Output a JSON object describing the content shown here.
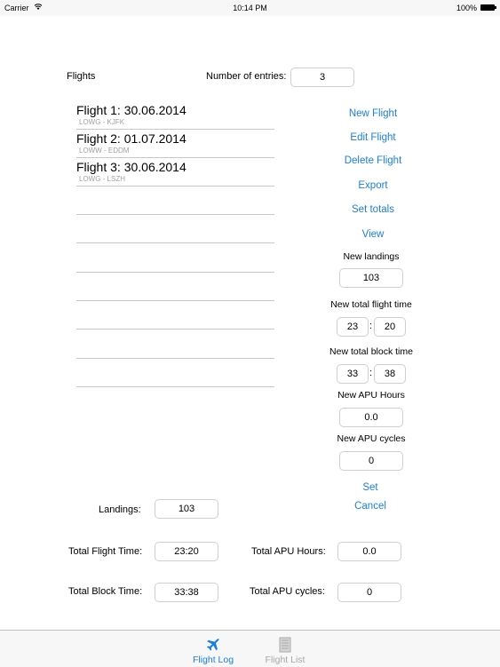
{
  "status_bar": {
    "carrier": "Carrier",
    "time": "10:14 PM",
    "battery": "100%"
  },
  "header": {
    "flights_label": "Flights",
    "entries_label": "Number of entries:",
    "entries_value": "3"
  },
  "flights": [
    {
      "title": "Flight 1: 30.06.2014",
      "route": "LOWG -  KJFK"
    },
    {
      "title": "Flight 2: 01.07.2014",
      "route": "LOWW -  EDDM"
    },
    {
      "title": "Flight 3: 30.06.2014",
      "route": "LOWG -  LSZH"
    }
  ],
  "actions": {
    "new_flight": "New Flight",
    "edit_flight": "Edit Flight",
    "delete_flight": "Delete Flight",
    "export": "Export",
    "set_totals": "Set totals",
    "view": "View"
  },
  "set_totals_form": {
    "new_landings_label": "New landings",
    "new_landings_value": "103",
    "flight_time_label": "New total flight time",
    "flight_time_hours": "23",
    "flight_time_minutes": "20",
    "block_time_label": "New total block time",
    "block_time_hours": "33",
    "block_time_minutes": "38",
    "separator": ":",
    "apu_hours_label": "New APU Hours",
    "apu_hours_value": "0.0",
    "apu_cycles_label": "New APU cycles",
    "apu_cycles_value": "0",
    "set": "Set",
    "cancel": "Cancel"
  },
  "totals": {
    "landings_label": "Landings:",
    "landings_value": "103",
    "flight_time_label": "Total Flight Time:",
    "flight_time_value": "23:20",
    "block_time_label": "Total Block Time:",
    "block_time_value": "33:38",
    "apu_hours_label": "Total APU Hours:",
    "apu_hours_value": "0.0",
    "apu_cycles_label": "Total APU cycles:",
    "apu_cycles_value": "0"
  },
  "tabbar": {
    "tabs": [
      {
        "label": "Flight Log",
        "icon": "airplane-icon",
        "active": true,
        "color": "#1a7fe0"
      },
      {
        "label": "Flight List",
        "icon": "list-icon",
        "active": false,
        "color": "#a8a8a8"
      }
    ]
  }
}
